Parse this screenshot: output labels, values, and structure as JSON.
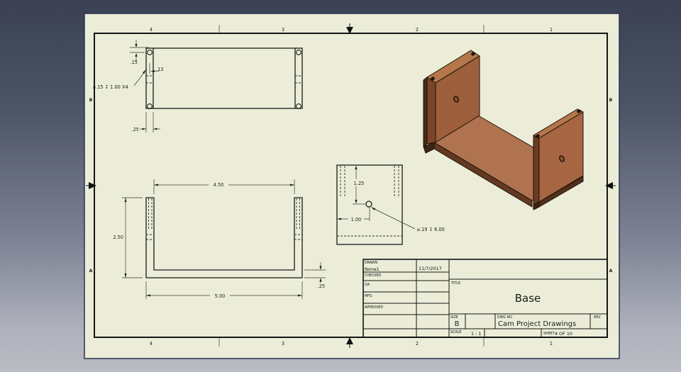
{
  "sheet": {
    "zones_top": [
      "4",
      "3",
      "2",
      "1"
    ],
    "zones_bottom": [
      "4",
      "3",
      "2",
      "1"
    ],
    "zone_letters_left": [
      "B",
      "A"
    ],
    "zone_letters_right": [
      "B",
      "A"
    ]
  },
  "title_block": {
    "drawn_label": "DRAWN",
    "drawn_value": "None1",
    "drawn_date": "11/7/2017",
    "checked_label": "CHECKED",
    "qa_label": "QA",
    "mfg_label": "MFG",
    "approved_label": "APPROVED",
    "title_label": "TITLE",
    "title_value": "Base",
    "size_label": "SIZE",
    "size_value": "B",
    "dwg_label": "DWG NO",
    "dwg_value": "Cam Project Drawings",
    "rev_label": "REV",
    "scale_label": "SCALE",
    "scale_value": "1 : 1",
    "sheet_label": "SHEET",
    "sheet_value": "4  OF 10"
  },
  "dimensions": {
    "top_view": {
      "hole_edge": ".15",
      "hole_side": ".13",
      "hole_callout": "⌀.15 ↧ 1.00 X4",
      "wall_thickness": ".25"
    },
    "front_view": {
      "inner_width": "4.50",
      "height": "2.50",
      "overall_width": "5.00",
      "base_thickness": ".25"
    },
    "side_view": {
      "hole_from_top": "1.25",
      "hole_from_left": "1.00",
      "hole_callout": "⌀.19 ↧ 6.00"
    }
  }
}
